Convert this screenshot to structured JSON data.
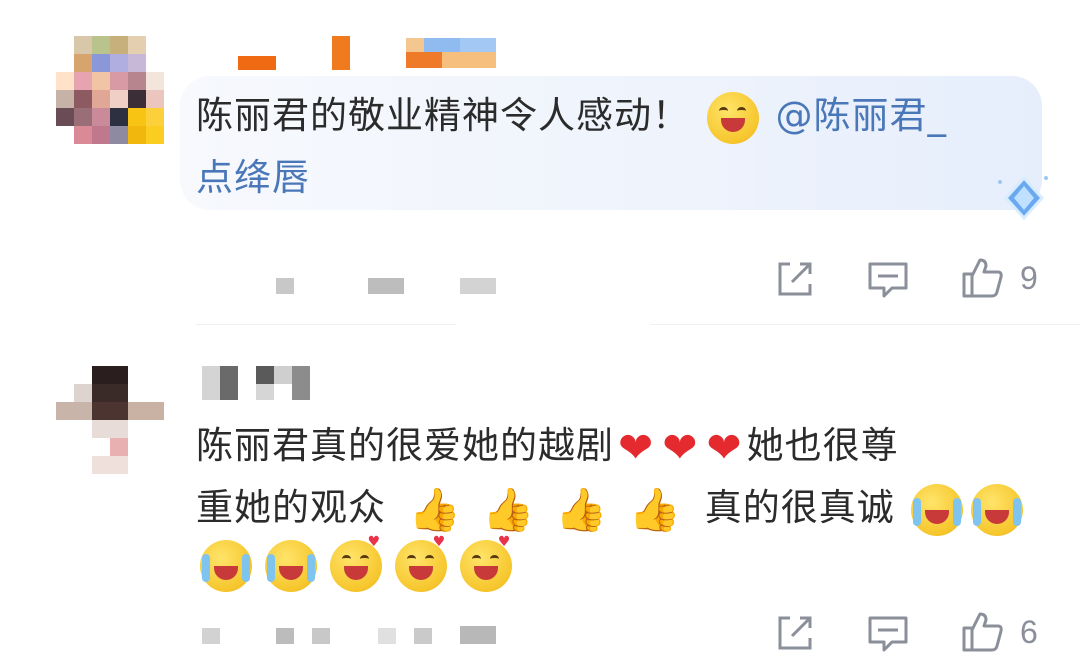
{
  "comments": [
    {
      "text_line1": "陈丽君的敬业精神令人感动！",
      "mention_part1": "@陈丽君_",
      "mention_part2": "点绛唇",
      "like_count": "9"
    },
    {
      "text_line1_a": "陈丽君真的很爱她的越剧",
      "text_line1_b": "她也很尊",
      "text_line2_a": "重她的观众",
      "text_line2_b": "真的很真诚",
      "like_count": "6"
    }
  ],
  "icons": {
    "share": "share-icon",
    "comment": "comment-icon",
    "like": "thumbs-up-icon",
    "badge": "diamond-badge-icon"
  },
  "colors": {
    "mention": "#4a77b8",
    "bubble": "#eef3fc",
    "action": "#8a8f99"
  }
}
